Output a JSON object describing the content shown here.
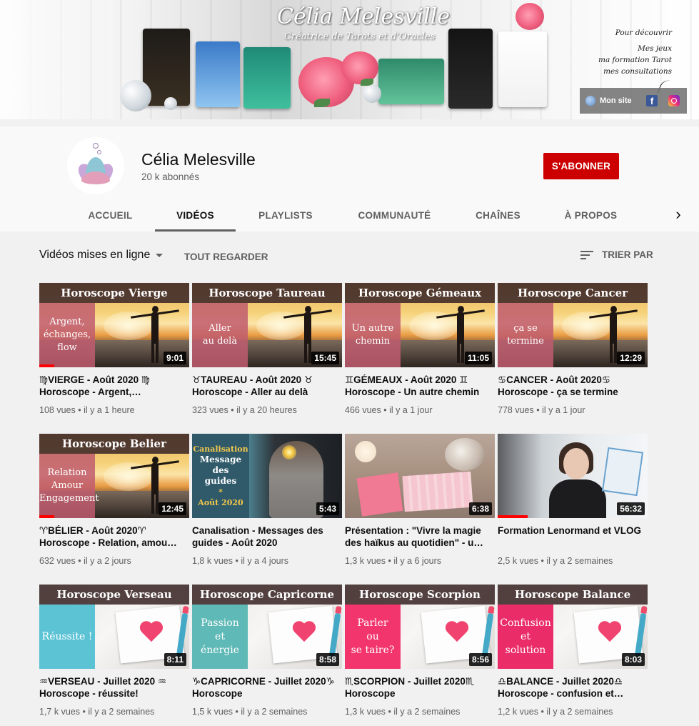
{
  "banner": {
    "title": "Célia Melesville",
    "subtitle": "Créatrice de Tarots et d'Oracles",
    "discover_intro": "Pour découvrir",
    "discover_lines": [
      "Mes jeux",
      "ma formation Tarot",
      "mes consultations"
    ],
    "my_site": "Mon site"
  },
  "channel": {
    "name": "Célia Melesville",
    "subscribers": "20 k abonnés",
    "subscribe_label": "S'ABONNER"
  },
  "tabs": [
    "ACCUEIL",
    "VIDÉOS",
    "PLAYLISTS",
    "COMMUNAUTÉ",
    "CHAÎNES",
    "À PROPOS"
  ],
  "active_tab": "VIDÉOS",
  "filter": {
    "label": "Vidéos mises en ligne",
    "play_all": "TOUT REGARDER",
    "sort": "TRIER PAR"
  },
  "videos": [
    {
      "thumb_title": "Horoscope Vierge",
      "thumb_text": [
        "Argent,",
        "échanges,",
        "flow"
      ],
      "duration": "9:01",
      "progress": 0.1,
      "title": "♍VIERGE - Août 2020 ♍ Horoscope - Argent,…",
      "views": "108 vues",
      "age": "il y a 1 heure"
    },
    {
      "thumb_title": "Horoscope Taureau",
      "thumb_text": [
        "Aller",
        "au delà"
      ],
      "duration": "15:45",
      "progress": 0,
      "title": "♉TAUREAU - Août 2020 ♉ Horoscope - Aller au delà",
      "views": "323 vues",
      "age": "il y a 20 heures"
    },
    {
      "thumb_title": "Horoscope Gémeaux",
      "thumb_text": [
        "Un autre",
        "chemin"
      ],
      "duration": "11:05",
      "progress": 0,
      "title": "♊GÉMEAUX - Août 2020 ♊ Horoscope - Un autre chemin",
      "views": "466 vues",
      "age": "il y a 1 jour"
    },
    {
      "thumb_title": "Horoscope Cancer",
      "thumb_text": [
        "ça se",
        "termine"
      ],
      "duration": "12:29",
      "progress": 0,
      "title": "♋CANCER - Août 2020♋ Horoscope - ça se termine",
      "views": "778 vues",
      "age": "il y a 1 jour"
    },
    {
      "thumb_title": "Horoscope Belier",
      "thumb_text": [
        "Relation",
        "Amour",
        "Engagement"
      ],
      "duration": "12:45",
      "progress": 0.1,
      "title": "♈BÉLIER - Août 2020♈ Horoscope - Relation, amou…",
      "views": "632 vues",
      "age": "il y a 2 jours"
    },
    {
      "thumb_title": "",
      "thumb_text": [
        "Canalisation",
        "Message",
        "des",
        "guides",
        "*",
        "Août 2020"
      ],
      "duration": "5:43",
      "progress": 0,
      "title": "Canalisation - Messages des guides - Août 2020",
      "views": "1,8 k vues",
      "age": "il y a 4 jours"
    },
    {
      "thumb_title": "",
      "thumb_text": [],
      "duration": "6:38",
      "progress": 0,
      "title": "Présentation : \"Vivre la magie des haïkus au quotidien\" - u…",
      "views": "1,3 k vues",
      "age": "il y a 6 jours"
    },
    {
      "thumb_title": "",
      "thumb_text": [],
      "duration": "56:32",
      "progress": 0.2,
      "title": "Formation Lenormand et VLOG",
      "views": "2,5 k vues",
      "age": "il y a 2 semaines"
    },
    {
      "thumb_title": "Horoscope Verseau",
      "thumb_text": [
        "Réussite !"
      ],
      "duration": "8:11",
      "progress": 0,
      "title": "♒VERSEAU - Juillet 2020 ♒ Horoscope - réussite!",
      "views": "1,7 k vues",
      "age": "il y a 2 semaines"
    },
    {
      "thumb_title": "Horoscope Capricorne",
      "thumb_text": [
        "Passion",
        "et",
        "énergie"
      ],
      "duration": "8:58",
      "progress": 0,
      "title": "♑CAPRICORNE - Juillet 2020♑ Horoscope",
      "views": "1,5 k vues",
      "age": "il y a 2 semaines"
    },
    {
      "thumb_title": "Horoscope Scorpion",
      "thumb_text": [
        "Parler",
        "ou",
        "se taire?"
      ],
      "duration": "8:56",
      "progress": 0,
      "title": "♏SCORPION - Juillet 2020♏ Horoscope",
      "views": "1,3 k vues",
      "age": "il y a 2 semaines"
    },
    {
      "thumb_title": "Horoscope Balance",
      "thumb_text": [
        "Confusion",
        "et",
        "solution"
      ],
      "duration": "8:03",
      "progress": 0,
      "title": "♎BALANCE - Juillet 2020♎ Horoscope - confusion et…",
      "views": "1,2 k vues",
      "age": "il y a 2 semaines"
    }
  ],
  "colors": {
    "subscribe": "#cc0000",
    "progress": "#ff0000",
    "sidebox_pink": "#c05c6e",
    "verseau_box": "#5cc3d4",
    "capricorne_box": "#5fb9b6",
    "scorpion_box": "#f2356d",
    "balance_box": "#ea2c68"
  }
}
